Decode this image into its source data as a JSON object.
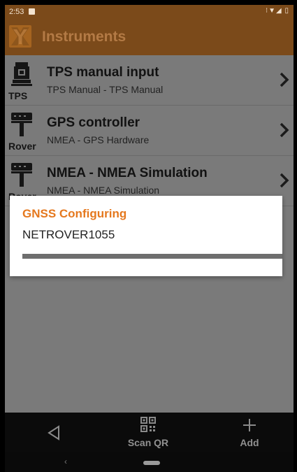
{
  "status_bar": {
    "time": "2:53",
    "icons": "⁝▼◢ ▯"
  },
  "app_bar": {
    "title": "Instruments",
    "logo_icon": "x-logo-icon"
  },
  "instruments": [
    {
      "title": "TPS manual input",
      "subtitle": "TPS Manual - TPS Manual",
      "device_label": "TPS",
      "icon": "total-station-icon"
    },
    {
      "title": "GPS controller",
      "subtitle": "NMEA - GPS Hardware",
      "device_label": "Rover",
      "icon": "gps-rover-icon"
    },
    {
      "title": "NMEA - NMEA Simulation",
      "subtitle": "NMEA - NMEA Simulation",
      "device_label": "Rover",
      "icon": "gps-rover-icon"
    }
  ],
  "dialog": {
    "title": "GNSS Configuring",
    "message": "NETROVER1055",
    "progress": 1.0
  },
  "bottom_bar": {
    "back_icon": "triangle-back-icon",
    "scan_qr_label": "Scan QR",
    "scan_qr_icon": "qr-code-icon",
    "add_label": "Add",
    "add_icon": "plus-icon"
  },
  "nav_bar": {
    "back_glyph": "‹",
    "home_icon": "home-pill-icon"
  },
  "colors": {
    "app_bar": "#7b4a1a",
    "accent_orange": "#e5781e",
    "list_background": "#7a7a7a"
  }
}
